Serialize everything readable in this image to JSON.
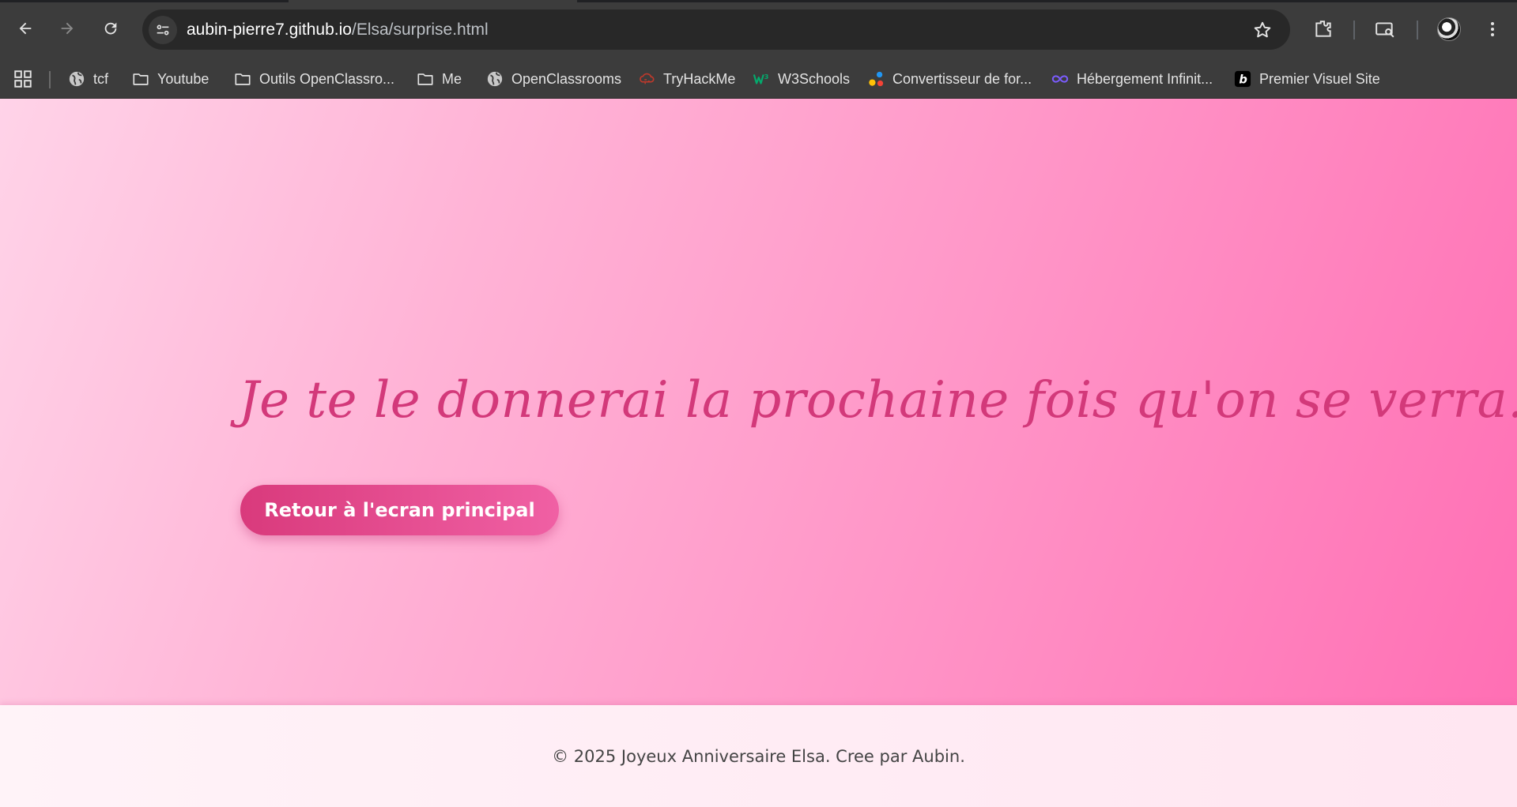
{
  "browser": {
    "url_host": "aubin-pierre7.github.io",
    "url_path": "/Elsa/surprise.html",
    "bookmarks": [
      {
        "label": "tcf",
        "icon": "globe-icon"
      },
      {
        "label": "Youtube",
        "icon": "folder-icon"
      },
      {
        "label": "Outils OpenClassro...",
        "icon": "folder-icon"
      },
      {
        "label": "Me",
        "icon": "folder-icon"
      },
      {
        "label": "OpenClassrooms",
        "icon": "globe-icon"
      },
      {
        "label": "TryHackMe",
        "icon": "tryhackme-icon"
      },
      {
        "label": "W3Schools",
        "icon": "w3schools-icon"
      },
      {
        "label": "Convertisseur de for...",
        "icon": "converter-icon"
      },
      {
        "label": "Hébergement Infinit...",
        "icon": "infinity-icon"
      },
      {
        "label": "Premier Visuel Site",
        "icon": "b-logo-icon"
      }
    ]
  },
  "page": {
    "message": "Je te le donnerai la prochaine fois qu'on se verra...",
    "back_button_label": "Retour à l'ecran principal",
    "footer_text": "© 2025 Joyeux Anniversaire Elsa. Cree par Aubin."
  },
  "colors": {
    "accent": "#d93a7c",
    "hero_gradient_start": "#ffd3e8",
    "hero_gradient_end": "#ff6fb4",
    "message_color": "#d3397a"
  }
}
